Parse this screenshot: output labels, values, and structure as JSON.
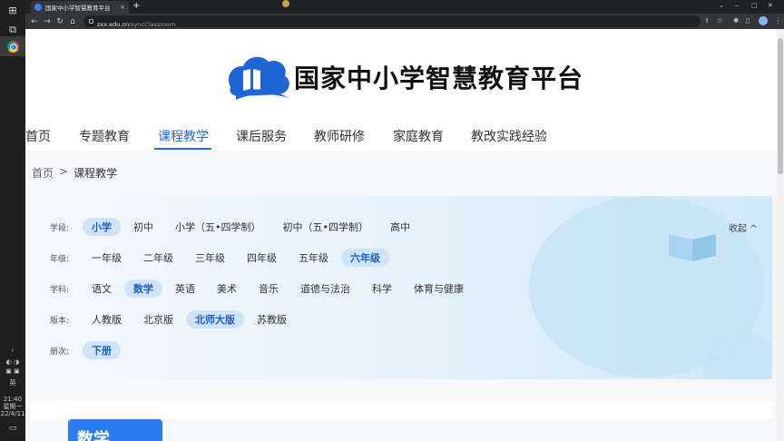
{
  "browser": {
    "tab_title": "国家中小学智慧教育平台",
    "tab_close": "×",
    "new_tab": "+",
    "url_host": "zxx.edu.cn",
    "url_path": "/syncClassroom",
    "nav_back": "←",
    "nav_forward": "→",
    "nav_reload": "↻",
    "nav_home": "⌂",
    "win_min": "‒",
    "win_max": "▢",
    "win_close": "✕",
    "tab_list": "⌄"
  },
  "taskbar": {
    "time": "21:40",
    "weekday": "星期一",
    "date": "22/4/11"
  },
  "site": {
    "title": "国家中小学智慧教育平台"
  },
  "nav": {
    "items": [
      {
        "label": "首页"
      },
      {
        "label": "专题教育"
      },
      {
        "label": "课程教学"
      },
      {
        "label": "课后服务"
      },
      {
        "label": "教师研修"
      },
      {
        "label": "家庭教育"
      },
      {
        "label": "教改实践经验"
      }
    ],
    "active_index": 2
  },
  "breadcrumb": {
    "home": "首页",
    "separator": ">",
    "current": "课程教学"
  },
  "filters": {
    "collapse_label": "收起 ^",
    "stage": {
      "label": "学段:",
      "options": [
        "小学",
        "初中",
        "小学（五•四学制）",
        "初中（五•四学制）",
        "高中"
      ],
      "selected": 0
    },
    "grade": {
      "label": "年级:",
      "options": [
        "一年级",
        "二年级",
        "三年级",
        "四年级",
        "五年级",
        "六年级"
      ],
      "selected": 5
    },
    "subject": {
      "label": "学科:",
      "options": [
        "语文",
        "数学",
        "英语",
        "美术",
        "音乐",
        "道德与法治",
        "科学",
        "体育与健康"
      ],
      "selected": 1
    },
    "edition": {
      "label": "版本:",
      "options": [
        "人教版",
        "北京版",
        "北师大版",
        "苏教版"
      ],
      "selected": 2
    },
    "volume": {
      "label": "册次:",
      "options": [
        "下册"
      ],
      "selected": 0
    }
  },
  "subject_card": {
    "label": "数学"
  },
  "colors": {
    "accent": "#1f6bd6",
    "selected_bg": "#cfe3f9",
    "card_blue": "#2c7ef0"
  }
}
